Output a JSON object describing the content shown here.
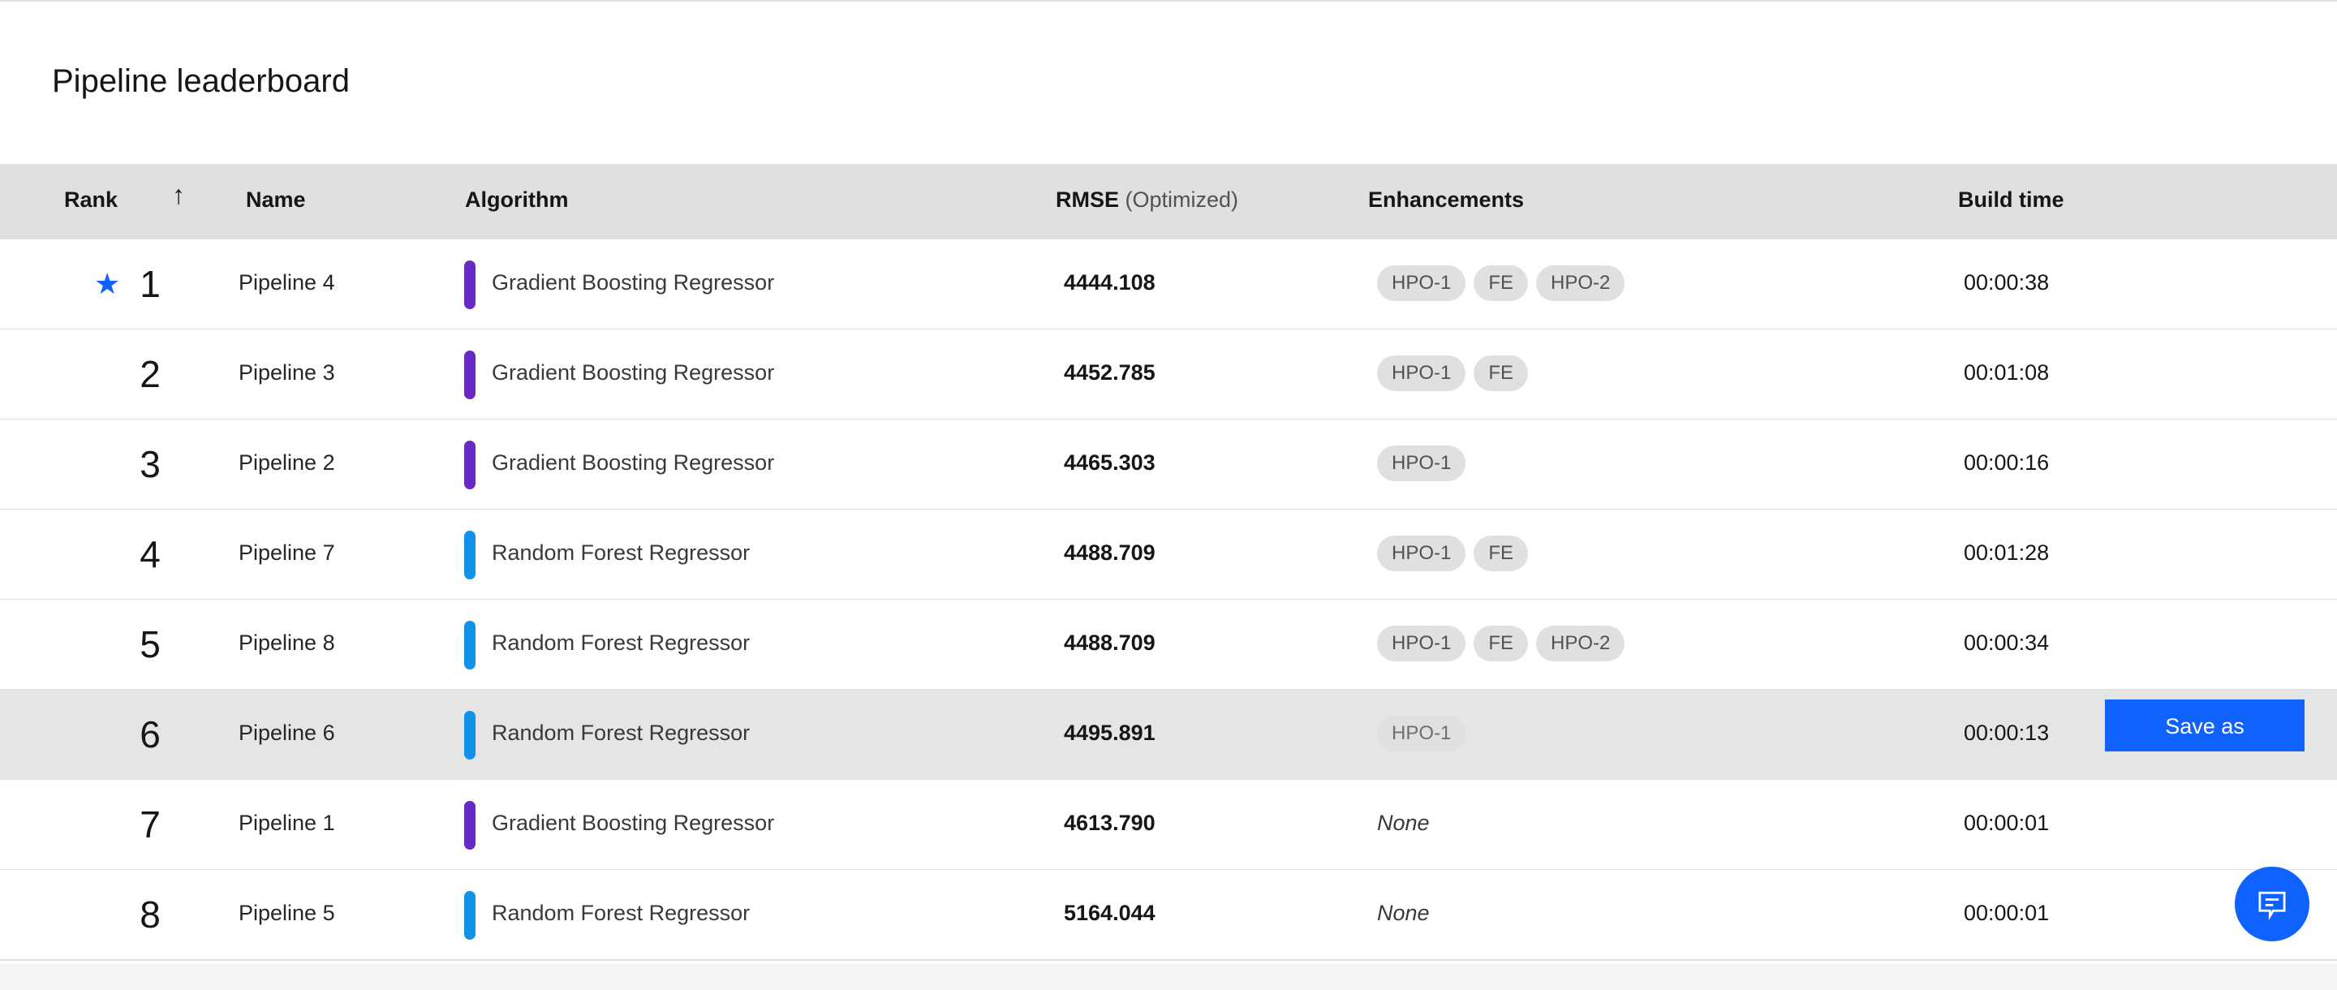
{
  "title": "Pipeline leaderboard",
  "columns": {
    "rank": "Rank",
    "name": "Name",
    "algorithm": "Algorithm",
    "rmse": "RMSE",
    "rmse_sub": "(Optimized)",
    "enhancements": "Enhancements",
    "build_time": "Build time"
  },
  "colors": {
    "gradient_boosting": "#6929c4",
    "random_forest": "#1192e8",
    "accent": "#0f62fe"
  },
  "rows": [
    {
      "rank": "1",
      "name": "Pipeline 4",
      "algorithm": "Gradient Boosting Regressor",
      "rmse": "4444.108",
      "tags": [
        "HPO-1",
        "FE",
        "HPO-2"
      ],
      "build_time": "00:00:38",
      "starred": true
    },
    {
      "rank": "2",
      "name": "Pipeline 3",
      "algorithm": "Gradient Boosting Regressor",
      "rmse": "4452.785",
      "tags": [
        "HPO-1",
        "FE"
      ],
      "build_time": "00:01:08"
    },
    {
      "rank": "3",
      "name": "Pipeline 2",
      "algorithm": "Gradient Boosting Regressor",
      "rmse": "4465.303",
      "tags": [
        "HPO-1"
      ],
      "build_time": "00:00:16"
    },
    {
      "rank": "4",
      "name": "Pipeline 7",
      "algorithm": "Random Forest Regressor",
      "rmse": "4488.709",
      "tags": [
        "HPO-1",
        "FE"
      ],
      "build_time": "00:01:28"
    },
    {
      "rank": "5",
      "name": "Pipeline 8",
      "algorithm": "Random Forest Regressor",
      "rmse": "4488.709",
      "tags": [
        "HPO-1",
        "FE",
        "HPO-2"
      ],
      "build_time": "00:00:34"
    },
    {
      "rank": "6",
      "name": "Pipeline 6",
      "algorithm": "Random Forest Regressor",
      "rmse": "4495.891",
      "tags": [
        "HPO-1"
      ],
      "build_time": "00:00:13",
      "highlighted": true
    },
    {
      "rank": "7",
      "name": "Pipeline 1",
      "algorithm": "Gradient Boosting Regressor",
      "rmse": "4613.790",
      "tags": [],
      "none_label": "None",
      "build_time": "00:00:01"
    },
    {
      "rank": "8",
      "name": "Pipeline 5",
      "algorithm": "Random Forest Regressor",
      "rmse": "5164.044",
      "tags": [],
      "none_label": "None",
      "build_time": "00:00:01"
    }
  ],
  "save_as_label": "Save as"
}
